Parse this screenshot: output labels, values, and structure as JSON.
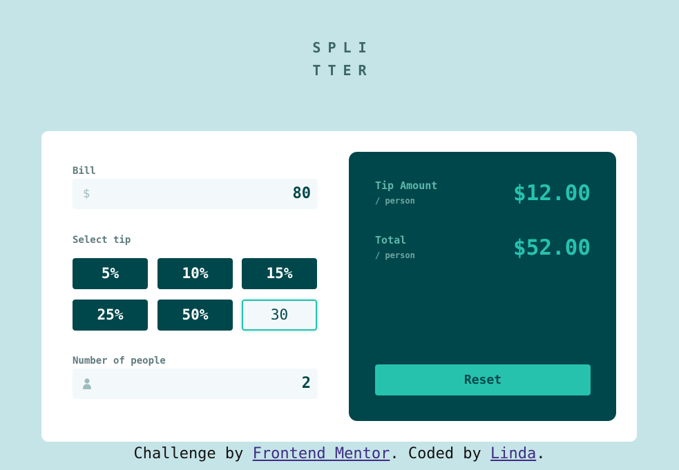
{
  "app": {
    "logo_line1": "SPLI",
    "logo_line2": "TTER"
  },
  "bill": {
    "label": "Bill",
    "prefix": "$",
    "value": "80"
  },
  "tip": {
    "label": "Select tip",
    "options": [
      "5%",
      "10%",
      "15%",
      "25%",
      "50%"
    ],
    "custom_value": "30"
  },
  "people": {
    "label": "Number of people",
    "value": "2"
  },
  "results": {
    "tip_label": "Tip Amount",
    "tip_sub": "/ person",
    "tip_value": "$12.00",
    "total_label": "Total",
    "total_sub": "/ person",
    "total_value": "$52.00",
    "reset_label": "Reset"
  },
  "footer": {
    "text1": "Challenge by ",
    "link1": "Frontend Mentor",
    "text2": ". Coded by ",
    "link2": "Linda",
    "text3": "."
  },
  "colors": {
    "background": "#c5e4e7",
    "dark_cyan": "#00474b",
    "accent": "#26c2ae"
  }
}
